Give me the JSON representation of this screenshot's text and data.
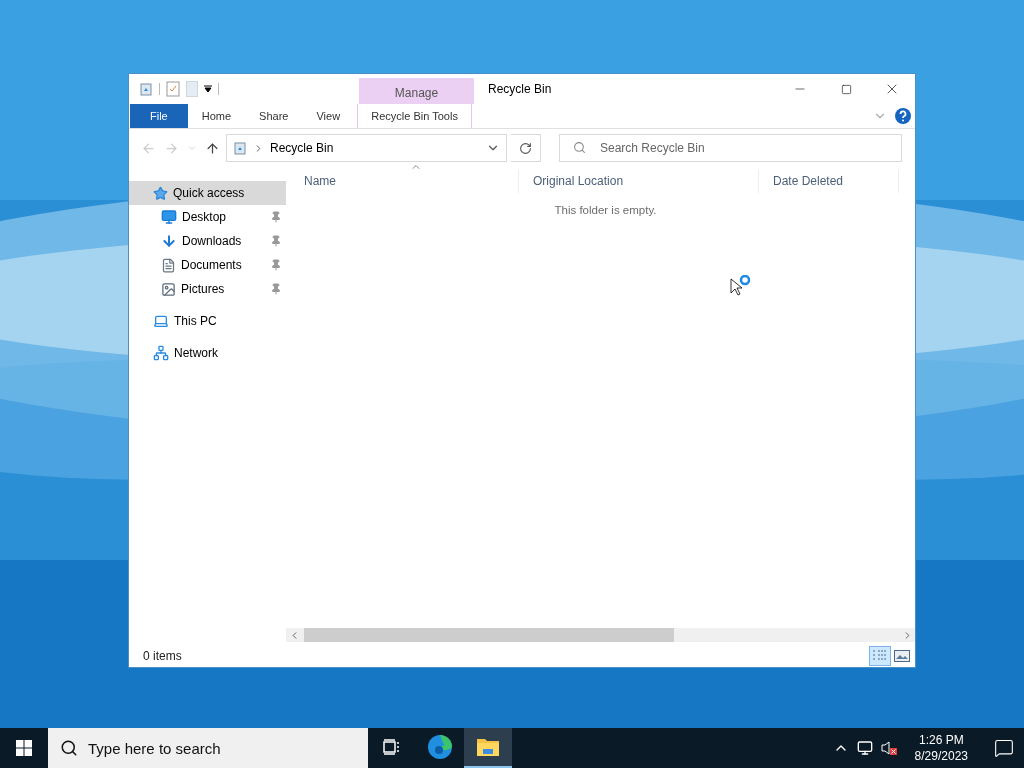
{
  "window": {
    "title": "Recycle Bin",
    "context_group": "Manage"
  },
  "ribbon": {
    "tabs": [
      {
        "label": "File",
        "kind": "file",
        "selected": false
      },
      {
        "label": "Home",
        "kind": "plain",
        "selected": false
      },
      {
        "label": "Share",
        "kind": "plain",
        "selected": false
      },
      {
        "label": "View",
        "kind": "plain",
        "selected": false
      },
      {
        "label": "Recycle Bin Tools",
        "kind": "contextual",
        "selected": false
      }
    ]
  },
  "address_bar": {
    "path": "Recycle Bin"
  },
  "search": {
    "placeholder": "Search Recycle Bin"
  },
  "nav": [
    {
      "label": "Quick access",
      "selected": true,
      "children": [
        {
          "label": "Desktop",
          "pinned": true,
          "selected": false
        },
        {
          "label": "Downloads",
          "pinned": true,
          "selected": false
        },
        {
          "label": "Documents",
          "pinned": true,
          "selected": false
        },
        {
          "label": "Pictures",
          "pinned": true,
          "selected": false
        }
      ]
    },
    {
      "label": "This PC",
      "selected": false
    },
    {
      "label": "Network",
      "selected": false
    }
  ],
  "columns": [
    {
      "label": "Name",
      "sorted": true
    },
    {
      "label": "Original Location",
      "sorted": false
    },
    {
      "label": "Date Deleted",
      "sorted": false
    }
  ],
  "empty_message": "This folder is empty.",
  "status_bar": {
    "count": "0 items",
    "views": [
      {
        "selected": true
      },
      {
        "selected": false
      }
    ]
  },
  "taskbar": {
    "search_placeholder": "Type here to search",
    "apps": [
      {
        "selected": false
      },
      {
        "selected": false
      },
      {
        "selected": true
      }
    ],
    "time": "1:26 PM",
    "date": "8/29/2023"
  }
}
